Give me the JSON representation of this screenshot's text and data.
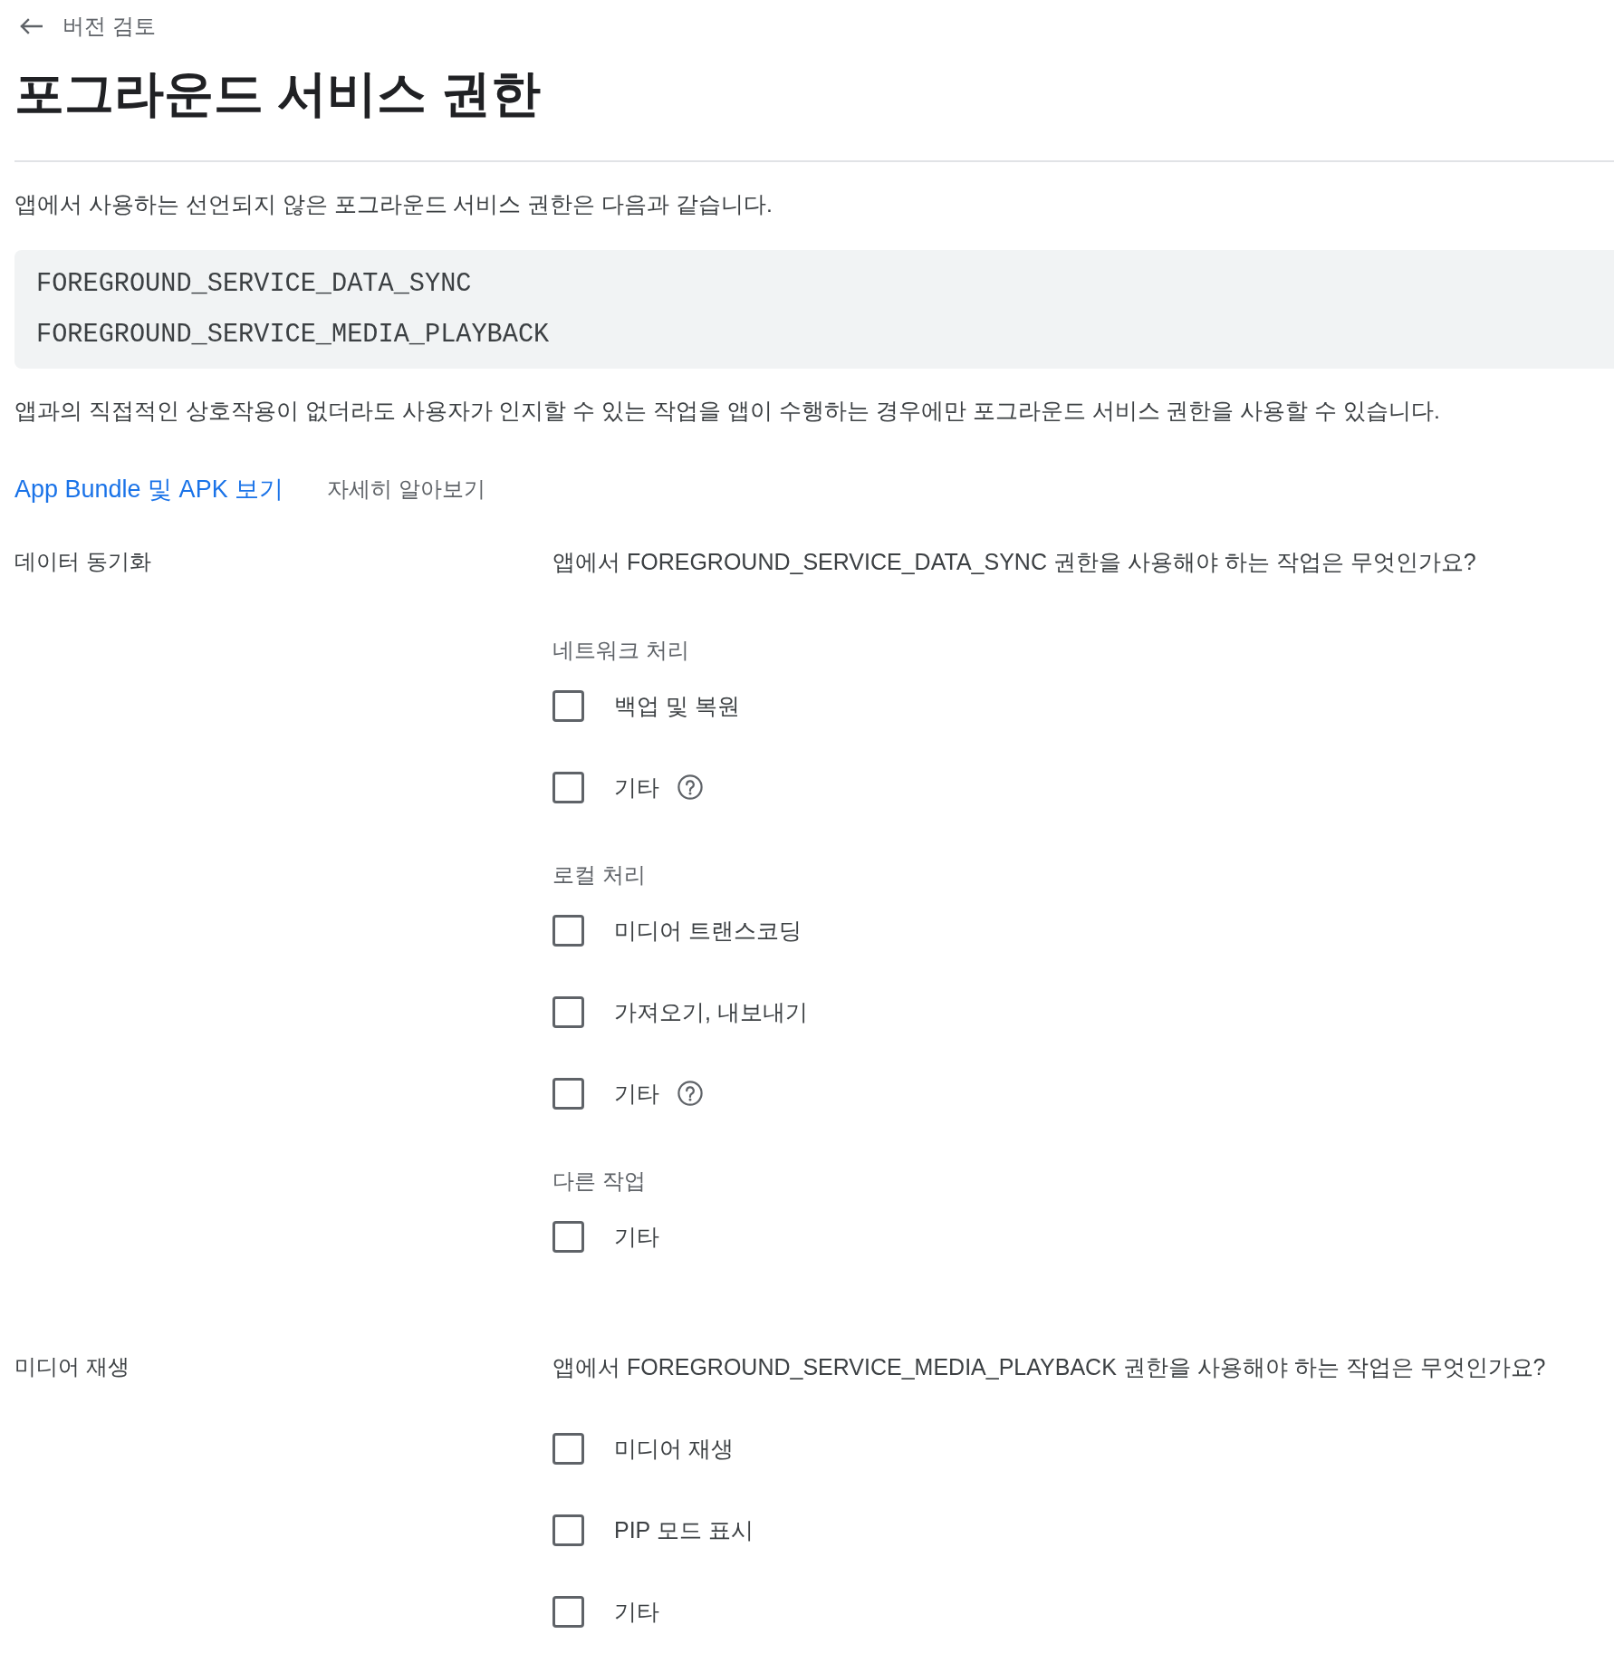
{
  "back_link": {
    "label": "버전 검토"
  },
  "title": "포그라운드 서비스 권한",
  "intro": "앱에서 사용하는 선언되지 않은 포그라운드 서비스 권한은 다음과 같습니다.",
  "undeclared_permissions": [
    "FOREGROUND_SERVICE_DATA_SYNC",
    "FOREGROUND_SERVICE_MEDIA_PLAYBACK"
  ],
  "note": "앱과의 직접적인 상호작용이 없더라도 사용자가 인지할 수 있는 작업을 앱이 수행하는 경우에만 포그라운드 서비스 권한을 사용할 수 있습니다.",
  "links": [
    {
      "label": "App Bundle 및 APK 보기",
      "kind": "primary"
    },
    {
      "label": "자세히 알아보기",
      "kind": "secondary"
    }
  ],
  "sections": [
    {
      "label": "데이터 동기화",
      "question": "앱에서 FOREGROUND_SERVICE_DATA_SYNC 권한을 사용해야 하는 작업은 무엇인가요?",
      "groups": [
        {
          "heading": "네트워크 처리",
          "options": [
            {
              "label": "백업 및 복원",
              "checked": false,
              "help": false
            },
            {
              "label": "기타",
              "checked": false,
              "help": true
            }
          ]
        },
        {
          "heading": "로컬 처리",
          "options": [
            {
              "label": "미디어 트랜스코딩",
              "checked": false,
              "help": false
            },
            {
              "label": "가져오기, 내보내기",
              "checked": false,
              "help": false
            },
            {
              "label": "기타",
              "checked": false,
              "help": true
            }
          ]
        },
        {
          "heading": "다른 작업",
          "options": [
            {
              "label": "기타",
              "checked": false,
              "help": false
            }
          ]
        }
      ]
    },
    {
      "label": "미디어 재생",
      "question": "앱에서 FOREGROUND_SERVICE_MEDIA_PLAYBACK 권한을 사용해야 하는 작업은 무엇인가요?",
      "groups": [
        {
          "options": [
            {
              "label": "미디어 재생",
              "checked": false,
              "help": false
            },
            {
              "label": "PIP 모드 표시",
              "checked": false,
              "help": false
            },
            {
              "label": "기타",
              "checked": false,
              "help": false
            }
          ]
        }
      ]
    }
  ]
}
